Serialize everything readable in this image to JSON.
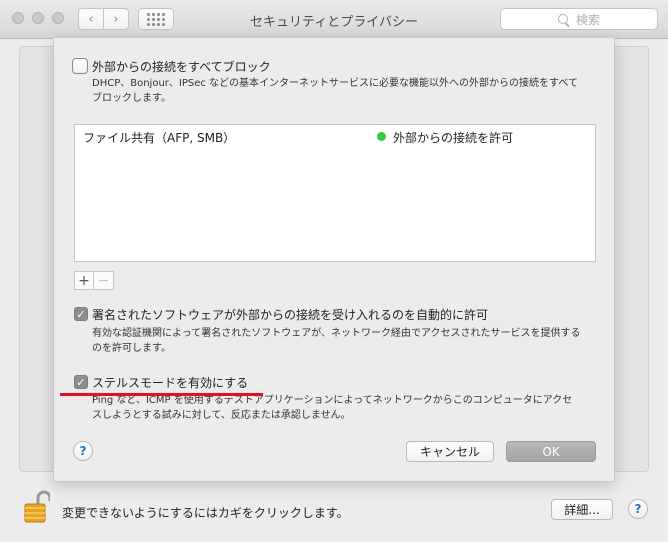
{
  "window": {
    "title": "セキュリティとプライバシー",
    "search_placeholder": "検索"
  },
  "sheet": {
    "block_all": {
      "label": "外部からの接続をすべてブロック",
      "checked": false,
      "description_line1": "DHCP、Bonjour、IPSec などの基本インターネットサービスに必要な機能以外への外部からの接続をすべて",
      "description_line2": "ブロックします。"
    },
    "services": [
      {
        "name": "ファイル共有（AFP, SMB）",
        "status": "外部からの接続を許可",
        "status_color": "#2ecc40"
      }
    ],
    "add_label": "+",
    "remove_label": "−",
    "signed_software": {
      "label": "署名されたソフトウェアが外部からの接続を受け入れるのを自動的に許可",
      "checked": true,
      "description_line1": "有効な認証機関によって署名されたソフトウェアが、ネットワーク経由でアクセスされたサービスを提供する",
      "description_line2": "のを許可します。"
    },
    "stealth_mode": {
      "label": "ステルスモードを有効にする",
      "checked": true,
      "description_line1": "Ping など、ICMP を使用するテストアプリケーションによってネットワークからこのコンピュータにアクセ",
      "description_line2": "スしようとする試みに対して、反応または承認しません。"
    },
    "help_label": "?",
    "cancel_label": "キャンセル",
    "ok_label": "OK"
  },
  "bottom": {
    "lock_text": "変更できないようにするにはカギをクリックします。",
    "advanced_label": "詳細...",
    "help_label": "?"
  },
  "colors": {
    "annotation_line": "#e3102a",
    "help_icon": "#2a6fd6"
  }
}
